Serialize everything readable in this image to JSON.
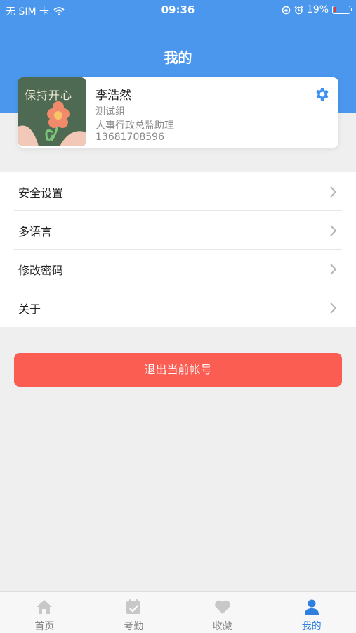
{
  "status_bar": {
    "carrier": "无 SIM 卡",
    "time": "09:36",
    "battery": "19%",
    "battery_level": 0.19
  },
  "header": {
    "title": "我的"
  },
  "profile": {
    "avatar_text": "保持开心",
    "name": "李浩然",
    "group": "测试组",
    "position": "人事行政总监助理",
    "phone": "13681708596"
  },
  "menu": {
    "items": [
      {
        "label": "安全设置"
      },
      {
        "label": "多语言"
      },
      {
        "label": "修改密码"
      },
      {
        "label": "关于"
      }
    ]
  },
  "logout": {
    "label": "退出当前帐号"
  },
  "tabbar": {
    "tabs": [
      {
        "label": "首页",
        "icon": "home-icon"
      },
      {
        "label": "考勤",
        "icon": "calendar-check-icon"
      },
      {
        "label": "收藏",
        "icon": "heart-icon"
      },
      {
        "label": "我的",
        "icon": "user-icon"
      }
    ],
    "active_index": 3
  },
  "colors": {
    "primary": "#4a97ed",
    "logout": "#fb5d53",
    "tab_active": "#2f7fe0",
    "tab_inactive": "#c8c8c8"
  }
}
